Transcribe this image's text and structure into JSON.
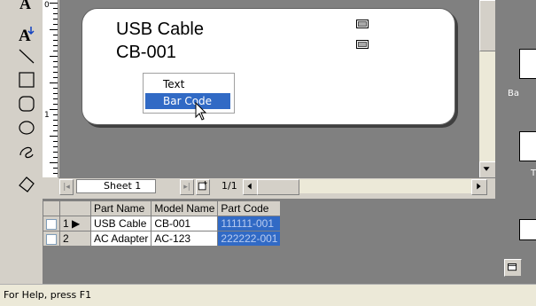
{
  "label_card": {
    "line1": "USB Cable",
    "line2": "CB-001"
  },
  "context_menu": {
    "items": [
      "Text",
      "Bar Code"
    ],
    "selected": "Bar Code"
  },
  "ruler": {
    "marks": [
      "0",
      "1"
    ]
  },
  "sheetbar": {
    "sheet_name": "Sheet 1",
    "page_indicator": "1/1"
  },
  "grid": {
    "headers": [
      "Part Name",
      "Model Name",
      "Part Code"
    ],
    "rows": [
      {
        "index": "1",
        "part_name": "USB Cable",
        "model_name": "CB-001",
        "part_code": "111111-001"
      },
      {
        "index": "2",
        "part_name": "AC Adapter",
        "model_name": "AC-123",
        "part_code": "222222-001"
      }
    ]
  },
  "right_panel": {
    "labels": [
      "Ba",
      "T"
    ]
  },
  "status": {
    "text": "For Help, press F1"
  },
  "colors": {
    "selection": "#316ac5",
    "canvas_bg": "#808080",
    "face": "#d4d0c8"
  },
  "icons": [
    "text-tool-icon",
    "text-insert-icon",
    "line-tool-icon",
    "rectangle-tool-icon",
    "rounded-rectangle-tool-icon",
    "ellipse-tool-icon",
    "freeform-tool-icon",
    "polygon-tool-icon",
    "selection-tool-icon",
    "field-marker-icon",
    "cursor-arrow-icon"
  ]
}
